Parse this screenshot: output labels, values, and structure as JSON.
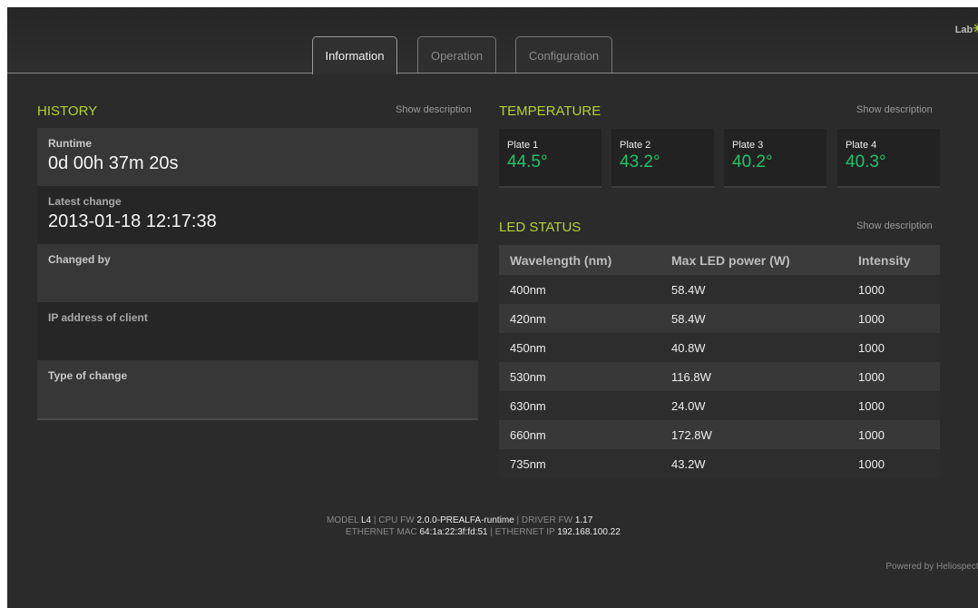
{
  "brand": "Lab",
  "tabs": [
    "Information",
    "Operation",
    "Configuration"
  ],
  "active_tab": "Information",
  "show_description": "Show description",
  "history": {
    "title": "HISTORY",
    "rows": [
      {
        "label": "Runtime",
        "value": "0d 00h 37m 20s"
      },
      {
        "label": "Latest change",
        "value": "2013-01-18 12:17:38"
      },
      {
        "label": "Changed by",
        "value": ""
      },
      {
        "label": "IP address of client",
        "value": ""
      },
      {
        "label": "Type of change",
        "value": ""
      }
    ]
  },
  "temperature": {
    "title": "TEMPERATURE",
    "plates": [
      {
        "label": "Plate 1",
        "value": "44.5°"
      },
      {
        "label": "Plate 2",
        "value": "43.2°"
      },
      {
        "label": "Plate 3",
        "value": "40.2°"
      },
      {
        "label": "Plate 4",
        "value": "40.3°"
      }
    ],
    "value_color": "#1ec36a"
  },
  "led_status": {
    "title": "LED STATUS",
    "columns": [
      "Wavelength (nm)",
      "Max LED power (W)",
      "Intensity"
    ],
    "rows": [
      [
        "400nm",
        "58.4W",
        "1000"
      ],
      [
        "420nm",
        "58.4W",
        "1000"
      ],
      [
        "450nm",
        "40.8W",
        "1000"
      ],
      [
        "530nm",
        "116.8W",
        "1000"
      ],
      [
        "630nm",
        "24.0W",
        "1000"
      ],
      [
        "660nm",
        "172.8W",
        "1000"
      ],
      [
        "735nm",
        "43.2W",
        "1000"
      ]
    ]
  },
  "footer": {
    "model_label": "MODEL",
    "model": "L4",
    "cpu_fw_label": "CPU FW",
    "cpu_fw": "2.0.0-PREALFA-runtime",
    "driver_fw_label": "DRIVER FW",
    "driver_fw": "1.17",
    "mac_label": "ETHERNET MAC",
    "mac": "64:1a:22:3f:fd:51",
    "ip_label": "ETHERNET IP",
    "ip": "192.168.100.22"
  },
  "powered_by": "Powered by Heliospectr",
  "accent_color": "#b2d235"
}
